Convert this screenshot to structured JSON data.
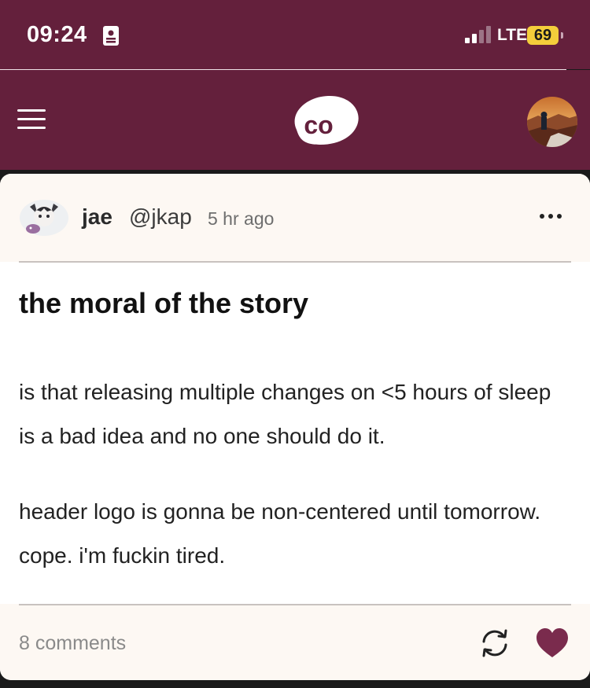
{
  "status_bar": {
    "time": "09:24",
    "network": "LTE",
    "battery": "69"
  },
  "header": {
    "logo_text": "co",
    "icons": [
      "menu-icon",
      "cohost-logo",
      "user-avatar"
    ]
  },
  "post": {
    "author": {
      "display_name": "jae",
      "handle": "@jkap",
      "time_ago": "5 hr ago"
    },
    "title": "the moral of the story",
    "paragraphs": [
      "is that releasing multiple changes on <5 hours of sleep is a bad idea and no one should do it.",
      "header logo is gonna be non-centered until tomorrow. cope. i'm fuckin tired."
    ],
    "comments_label": "8 comments"
  },
  "colors": {
    "brand": "#64203c",
    "card_header": "#fdf8f3",
    "like": "#7a2b4d"
  }
}
